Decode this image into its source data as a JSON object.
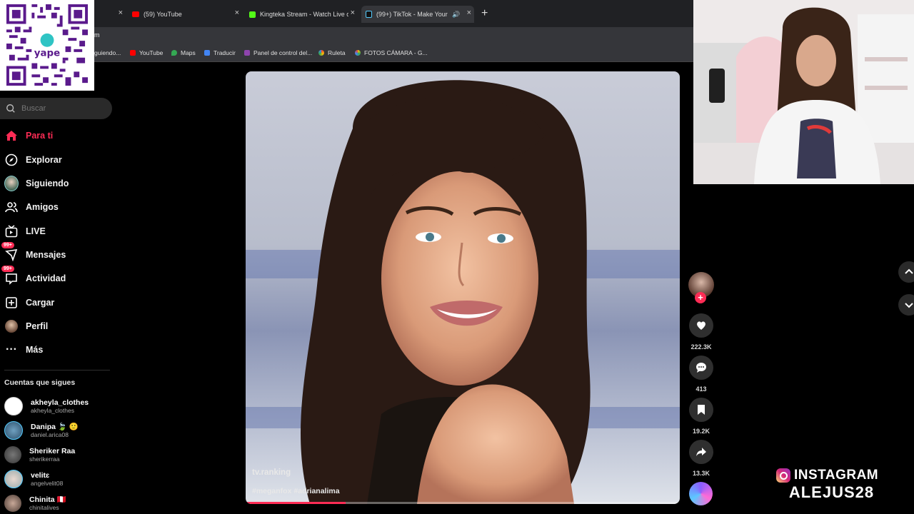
{
  "browser": {
    "tabs": [
      {
        "label": "",
        "icon": "tab-partial"
      },
      {
        "label": "(59) YouTube",
        "icon": "youtube-icon"
      },
      {
        "label": "Kingteka Stream - Watch Live o",
        "icon": "kick-icon"
      },
      {
        "label": "(99+) TikTok - Make Your Da",
        "icon": "tiktok-icon"
      }
    ],
    "address_fragment": "m",
    "bookmarks": [
      "guiendo...",
      "YouTube",
      "Maps",
      "Traducir",
      "Panel de control del...",
      "Ruleta",
      "FOTOS CÁMARA - G..."
    ]
  },
  "sidebar": {
    "search_placeholder": "Buscar",
    "nav": [
      {
        "label": "Para ti",
        "icon": "home-icon",
        "active": true
      },
      {
        "label": "Explorar",
        "icon": "compass-icon"
      },
      {
        "label": "Siguiendo",
        "icon": "following-avatar-icon"
      },
      {
        "label": "Amigos",
        "icon": "friends-icon"
      },
      {
        "label": "LIVE",
        "icon": "live-tv-icon"
      },
      {
        "label": "Mensajes",
        "icon": "messages-icon",
        "badge": "99+"
      },
      {
        "label": "Actividad",
        "icon": "activity-icon",
        "badge": "99+"
      },
      {
        "label": "Cargar",
        "icon": "upload-icon"
      },
      {
        "label": "Perfil",
        "icon": "profile-avatar-icon"
      },
      {
        "label": "Más",
        "icon": "more-icon"
      }
    ],
    "following_title": "Cuentas que sigues",
    "following": [
      {
        "name": "akheyla_clothes",
        "handle": "akheyla_clothes"
      },
      {
        "name": "Danipa 🍃 🙂",
        "handle": "daniel.arica08"
      },
      {
        "name": "Sheriker Raa",
        "handle": "sherikerraa"
      },
      {
        "name": "velitɛ",
        "handle": "angelvelit08"
      },
      {
        "name": "Chinita 🇵🇪",
        "handle": "chinitalives"
      }
    ]
  },
  "video": {
    "author": "tv.ranking",
    "hashtags": "#meganfox #adrianalima",
    "progress": 0.23
  },
  "actions": {
    "likes": "222.3K",
    "comments": "413",
    "saves": "19.2K",
    "shares": "13.3K"
  },
  "overlay": {
    "instagram_label": "INSTAGRAM",
    "instagram_handle": "ALEJUS28",
    "qr_brand": "yape"
  },
  "colors": {
    "accent": "#fe2c55",
    "background": "#000000",
    "chrome": "#35363a"
  }
}
